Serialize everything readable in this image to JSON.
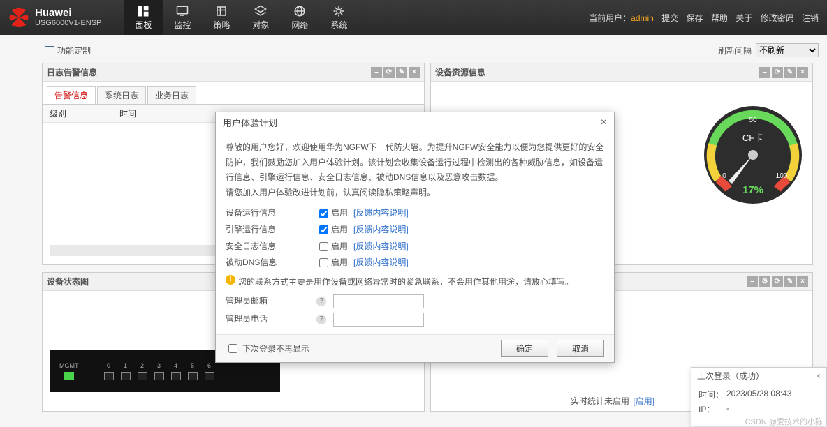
{
  "brand": {
    "name": "Huawei",
    "model": "USG6000V1-ENSP"
  },
  "nav": {
    "items": [
      {
        "label": "面板",
        "key": "dashboard",
        "active": true
      },
      {
        "label": "监控",
        "key": "monitor"
      },
      {
        "label": "策略",
        "key": "policy"
      },
      {
        "label": "对象",
        "key": "object"
      },
      {
        "label": "网络",
        "key": "network"
      },
      {
        "label": "系统",
        "key": "system"
      }
    ]
  },
  "header_right": {
    "label_current_user": "当前用户：",
    "user": "admin",
    "links": [
      "提交",
      "保存",
      "帮助",
      "关于",
      "修改密码",
      "注销"
    ]
  },
  "toolbar": {
    "customize": "功能定制",
    "refresh_label": "刷新间隔",
    "refresh_value": "不刷新"
  },
  "panels": {
    "alarm": {
      "title": "日志告警信息",
      "tabs": [
        "告警信息",
        "系统日志",
        "业务日志"
      ],
      "cols": {
        "level": "级别",
        "time": "时间"
      }
    },
    "resource": {
      "title": "设备资源信息"
    },
    "device": {
      "title": "设备状态图",
      "ports": [
        "MGMT",
        "0",
        "1",
        "2",
        "3",
        "4",
        "5",
        "6"
      ],
      "rt_stat_prefix": "实时统计未启用",
      "rt_stat_link": "[启用]"
    },
    "right_bot": {
      "title": ""
    }
  },
  "gauge": {
    "title": "CF卡",
    "min": "0",
    "mid": "50",
    "max": "100",
    "value": "17%"
  },
  "modal": {
    "title": "用户体验计划",
    "intro": "尊敬的用户您好，欢迎使用华为NGFW下一代防火墙。为提升NGFW安全能力以便为您提供更好的安全防护，我们鼓励您加入用户体验计划。该计划会收集设备运行过程中检测出的各种威胁信息，如设备运行信息、引擎运行信息、安全日志信息、被动DNS信息以及恶意攻击数据。",
    "intro2": "请您加入用户体验改进计划前，认真阅读隐私策略声明。",
    "enable_word": "启用",
    "feedback_link": "[反馈内容说明]",
    "opts": [
      {
        "label": "设备运行信息",
        "checked": true
      },
      {
        "label": "引擎运行信息",
        "checked": true
      },
      {
        "label": "安全日志信息",
        "checked": false
      },
      {
        "label": "被动DNS信息",
        "checked": false
      }
    ],
    "warn": "您的联系方式主要是用作设备或网络异常时的紧急联系，不会用作其他用途，请放心填写。",
    "admin_email": "管理员邮箱",
    "admin_phone": "管理员电话",
    "dont_show": "下次登录不再显示",
    "ok": "确定",
    "cancel": "取消"
  },
  "login_pop": {
    "title": "上次登录（成功）",
    "time_label": "时间：",
    "time_value": "2023/05/28 08:43",
    "ip_label": "IP：",
    "ip_value": "-"
  },
  "watermark": "CSDN @爱技术的小陈"
}
